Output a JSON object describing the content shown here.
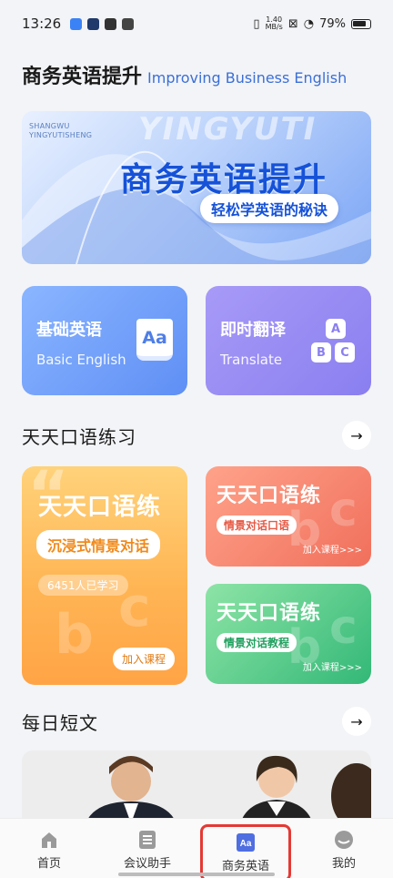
{
  "status_bar": {
    "time": "13:26",
    "speed_top": "1.40",
    "speed_bottom": "MB/s",
    "battery": "79%"
  },
  "page": {
    "title_cn": "商务英语提升",
    "title_en": "Improving Business English"
  },
  "banner": {
    "small_line1": "SHANGWU",
    "small_line2": "YINGYUTISHENG",
    "watermark": "YINGYUTI",
    "main_text": "商务英语提升",
    "pill_text": "轻松学英语的秘诀"
  },
  "features": [
    {
      "cn": "基础英语",
      "en": "Basic English",
      "icon": "aa-book-icon"
    },
    {
      "cn": "即时翻译",
      "en": "Translate",
      "icon": "abc-blocks-icon"
    }
  ],
  "practice": {
    "header": "天天口语练习",
    "big": {
      "title": "天天口语练",
      "pill": "沉浸式情景对话",
      "count": "6451人已学习",
      "join": "加入课程"
    },
    "cards": [
      {
        "title": "天天口语练",
        "pill": "情景对话口语",
        "join": "加入课程>>>"
      },
      {
        "title": "天天口语练",
        "pill": "情景对话教程",
        "join": "加入课程>>>"
      }
    ]
  },
  "daily": {
    "header": "每日短文"
  },
  "nav": {
    "items": [
      {
        "label": "首页",
        "icon": "home-icon"
      },
      {
        "label": "会议助手",
        "icon": "list-icon"
      },
      {
        "label": "商务英语",
        "icon": "aa-icon",
        "active": true
      },
      {
        "label": "我的",
        "icon": "profile-icon"
      }
    ]
  },
  "colors": {
    "accent": "#1552d8",
    "active_outline": "#e53935"
  }
}
